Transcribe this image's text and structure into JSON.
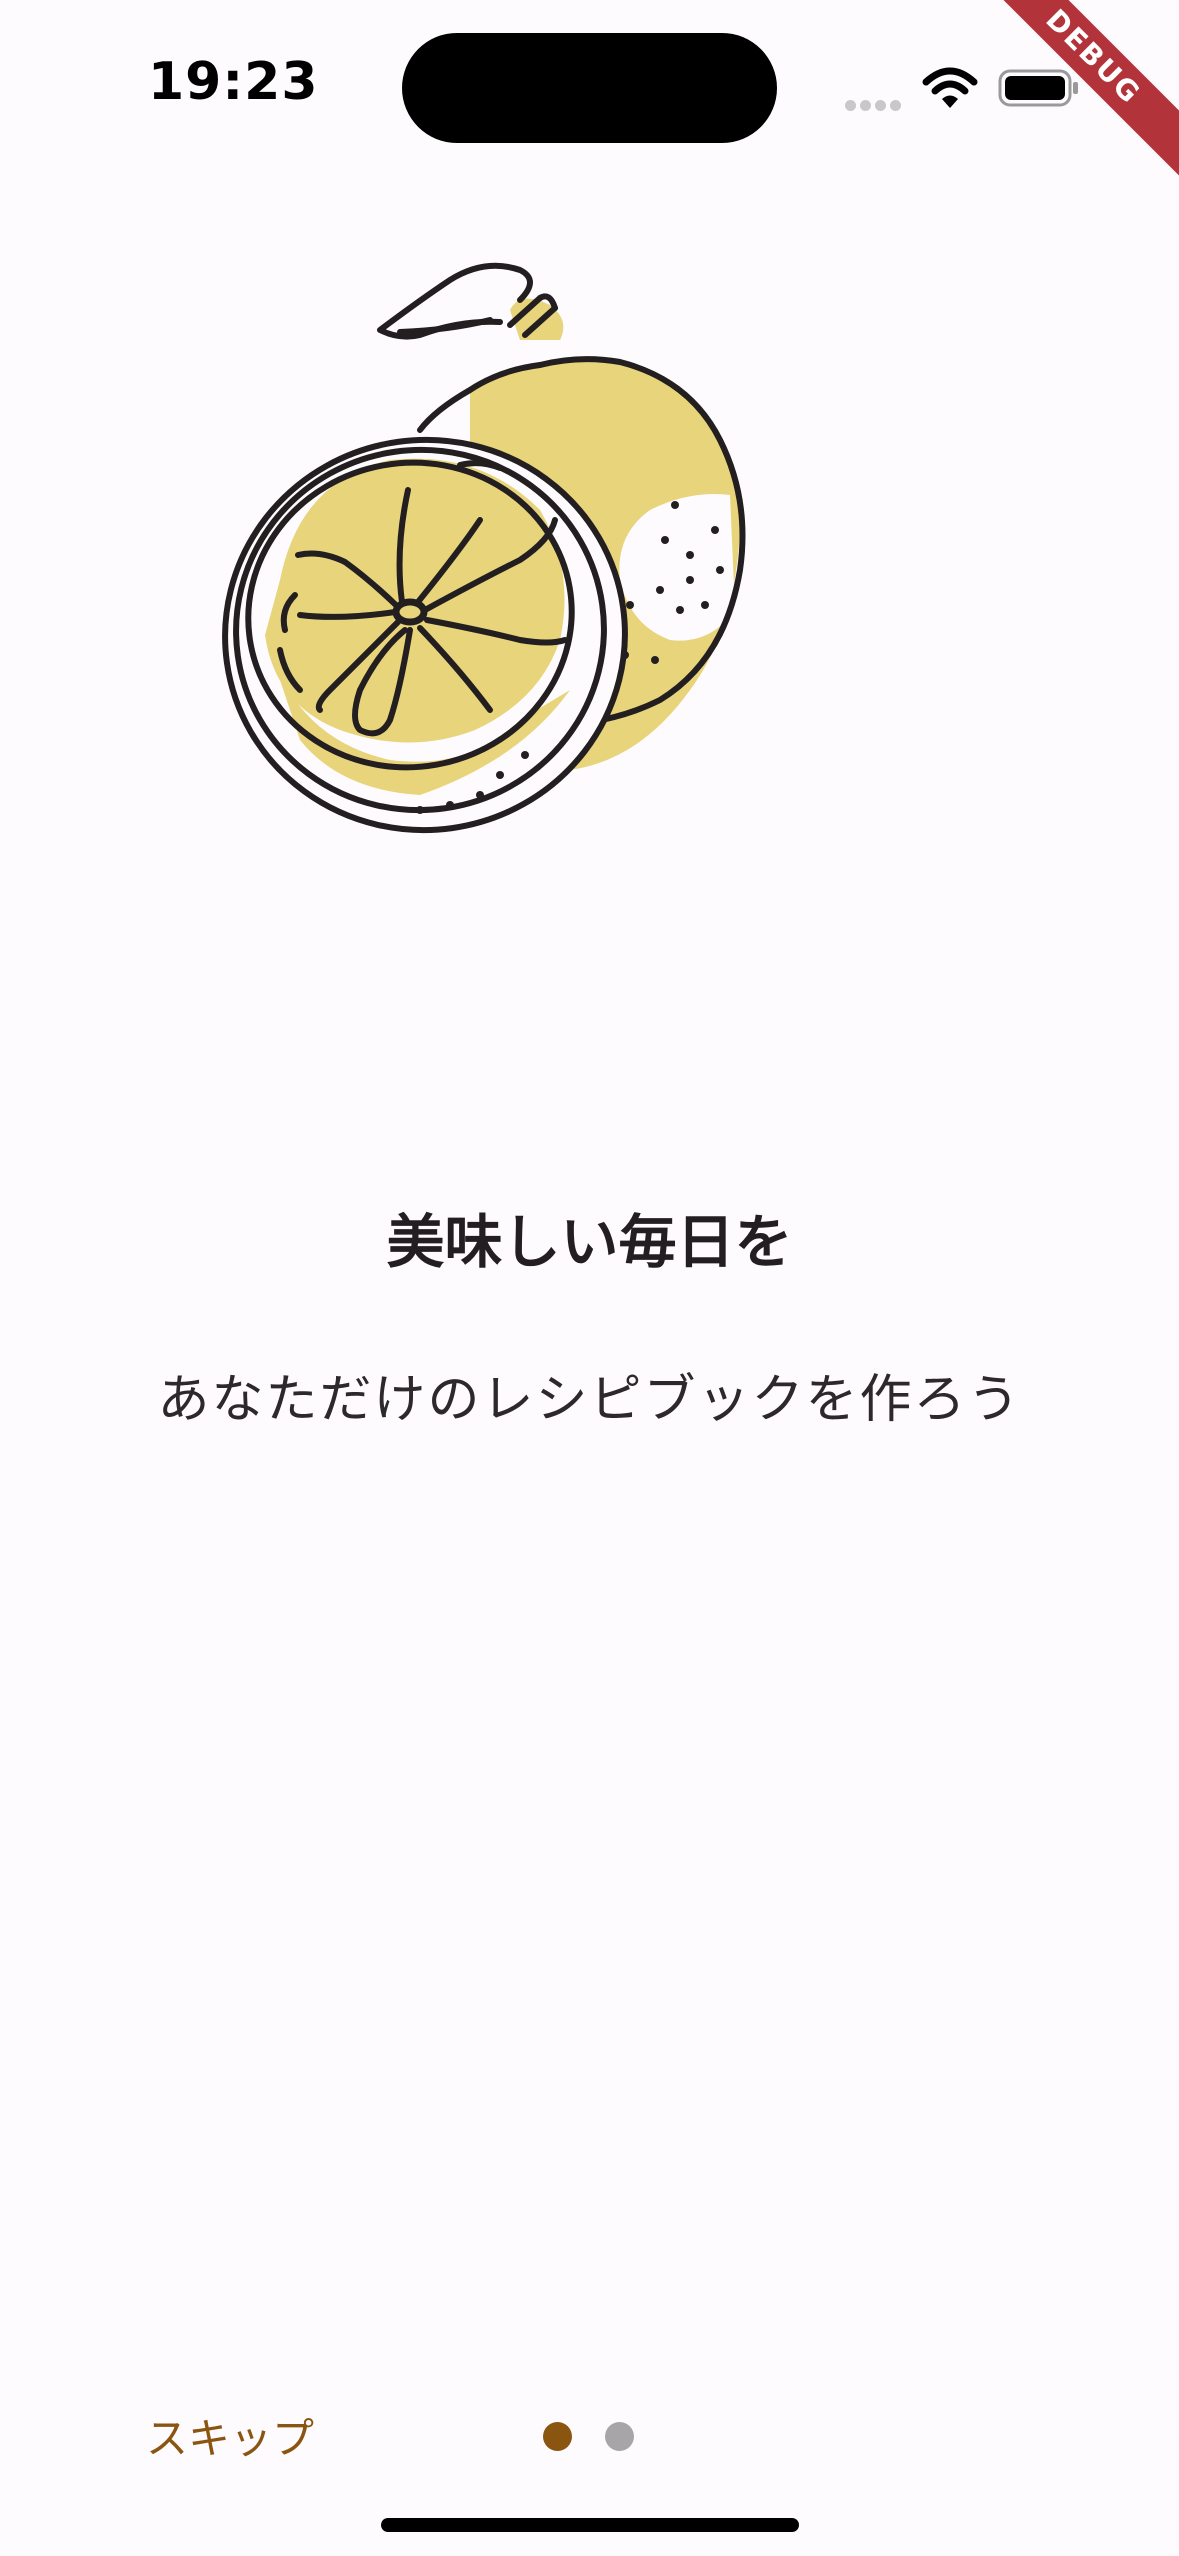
{
  "status_bar": {
    "time": "19:23"
  },
  "debug_banner": "DEBUG",
  "onboarding": {
    "illustration": "citrus-fruit-illustration",
    "title": "美味しい毎日を",
    "subtitle": "あなただけのレシピブックを作ろう"
  },
  "footer": {
    "skip_label": "スキップ",
    "page_count": 2,
    "current_page": 1
  },
  "colors": {
    "background": "#fefbfe",
    "fruit_fill": "#e8d47a",
    "outline": "#231f20",
    "active_dot": "#8a5510",
    "inactive_dot": "#a8a5a8",
    "skip_text": "#8a5510",
    "debug_ribbon": "#b3333a"
  }
}
